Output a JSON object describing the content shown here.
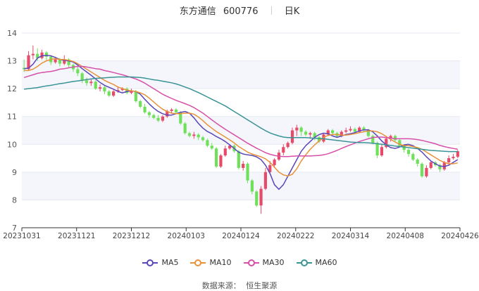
{
  "header": {
    "name": "东方通信",
    "code": "600776",
    "period": "日K"
  },
  "source": {
    "label": "数据来源：",
    "provider": "恒生聚源"
  },
  "chart_data": {
    "type": "candlestick",
    "ylim": [
      7,
      14
    ],
    "yticks": [
      7,
      8,
      9,
      10,
      11,
      12,
      13,
      14
    ],
    "xticks": [
      "20231031",
      "20231121",
      "20231212",
      "20240103",
      "20240124",
      "20240222",
      "20240314",
      "20240408",
      "20240426"
    ],
    "up_color": "#e84a6a",
    "down_color": "#6ee05a",
    "legend": [
      {
        "name": "MA5",
        "color": "#5b46b8"
      },
      {
        "name": "MA10",
        "color": "#e8923a"
      },
      {
        "name": "MA30",
        "color": "#d64fa8"
      },
      {
        "name": "MA60",
        "color": "#3a9396"
      }
    ],
    "series": [
      {
        "name": "MA5",
        "color": "#5b46b8",
        "values": [
          12.72,
          12.74,
          12.88,
          13.1,
          13.18,
          13.2,
          13.18,
          13.12,
          13.05,
          13.02,
          13.0,
          12.96,
          12.85,
          12.72,
          12.6,
          12.48,
          12.35,
          12.22,
          12.12,
          12.05,
          11.98,
          11.9,
          11.85,
          11.9,
          11.92,
          11.9,
          11.8,
          11.62,
          11.45,
          11.3,
          11.18,
          11.1,
          11.05,
          11.05,
          11.1,
          11.15,
          11.18,
          11.12,
          10.95,
          10.75,
          10.58,
          10.46,
          10.38,
          10.28,
          10.2,
          10.1,
          9.98,
          9.85,
          9.72,
          9.65,
          9.62,
          9.6,
          9.55,
          9.45,
          9.25,
          8.95,
          8.55,
          8.38,
          8.55,
          8.85,
          9.15,
          9.45,
          9.75,
          9.95,
          10.1,
          10.25,
          10.35,
          10.4,
          10.38,
          10.3,
          10.25,
          10.3,
          10.35,
          10.38,
          10.42,
          10.48,
          10.52,
          10.52,
          10.45,
          10.3,
          10.12,
          9.98,
          9.88,
          9.85,
          9.9,
          9.98,
          10.0,
          9.95,
          9.85,
          9.72,
          9.55,
          9.4,
          9.3,
          9.22,
          9.2,
          9.25,
          9.35,
          9.45
        ]
      },
      {
        "name": "MA10",
        "color": "#e8923a",
        "values": [
          12.65,
          12.65,
          12.7,
          12.8,
          12.92,
          13.0,
          13.05,
          13.08,
          13.05,
          13.05,
          13.02,
          12.98,
          12.9,
          12.8,
          12.7,
          12.6,
          12.5,
          12.4,
          12.3,
          12.22,
          12.15,
          12.06,
          12.0,
          11.95,
          11.92,
          11.9,
          11.85,
          11.78,
          11.66,
          11.52,
          11.38,
          11.26,
          11.18,
          11.12,
          11.1,
          11.1,
          11.12,
          11.12,
          11.08,
          10.98,
          10.85,
          10.7,
          10.58,
          10.46,
          10.36,
          10.26,
          10.16,
          10.05,
          9.92,
          9.82,
          9.72,
          9.65,
          9.6,
          9.55,
          9.48,
          9.35,
          9.18,
          9.0,
          8.9,
          8.86,
          8.92,
          9.12,
          9.4,
          9.62,
          9.82,
          9.98,
          10.12,
          10.25,
          10.32,
          10.35,
          10.35,
          10.33,
          10.33,
          10.35,
          10.38,
          10.42,
          10.45,
          10.48,
          10.48,
          10.45,
          10.38,
          10.28,
          10.18,
          10.08,
          10.0,
          9.95,
          9.95,
          9.92,
          9.88,
          9.82,
          9.72,
          9.62,
          9.52,
          9.42,
          9.35,
          9.3,
          9.3,
          9.33
        ]
      },
      {
        "name": "MA30",
        "color": "#d64fa8",
        "values": [
          12.4,
          12.45,
          12.5,
          12.55,
          12.58,
          12.6,
          12.62,
          12.65,
          12.7,
          12.72,
          12.75,
          12.78,
          12.8,
          12.8,
          12.78,
          12.75,
          12.72,
          12.7,
          12.65,
          12.62,
          12.58,
          12.54,
          12.5,
          12.45,
          12.4,
          12.35,
          12.28,
          12.2,
          12.1,
          12.0,
          11.9,
          11.8,
          11.72,
          11.65,
          11.58,
          11.52,
          11.46,
          11.4,
          11.32,
          11.22,
          11.12,
          11.0,
          10.88,
          10.76,
          10.65,
          10.54,
          10.44,
          10.34,
          10.24,
          10.14,
          10.04,
          9.95,
          9.86,
          9.78,
          9.7,
          9.64,
          9.6,
          9.57,
          9.56,
          9.56,
          9.57,
          9.58,
          9.58,
          9.58,
          9.58,
          9.59,
          9.6,
          9.62,
          9.66,
          9.72,
          9.78,
          9.85,
          9.92,
          9.98,
          10.04,
          10.1,
          10.15,
          10.2,
          10.24,
          10.26,
          10.26,
          10.24,
          10.22,
          10.2,
          10.2,
          10.2,
          10.2,
          10.19,
          10.17,
          10.14,
          10.1,
          10.06,
          10.02,
          9.96,
          9.92,
          9.88,
          9.85,
          9.82
        ]
      },
      {
        "name": "MA60",
        "color": "#3a9396",
        "values": [
          11.98,
          12.0,
          12.02,
          12.04,
          12.07,
          12.1,
          12.12,
          12.15,
          12.18,
          12.2,
          12.23,
          12.26,
          12.28,
          12.3,
          12.33,
          12.35,
          12.37,
          12.38,
          12.39,
          12.4,
          12.41,
          12.42,
          12.42,
          12.42,
          12.42,
          12.41,
          12.4,
          12.38,
          12.35,
          12.32,
          12.3,
          12.27,
          12.24,
          12.21,
          12.17,
          12.12,
          12.06,
          12.0,
          11.93,
          11.86,
          11.78,
          11.7,
          11.62,
          11.54,
          11.46,
          11.38,
          11.28,
          11.18,
          11.08,
          10.98,
          10.88,
          10.78,
          10.68,
          10.58,
          10.49,
          10.41,
          10.35,
          10.3,
          10.26,
          10.24,
          10.24,
          10.24,
          10.24,
          10.24,
          10.23,
          10.22,
          10.21,
          10.2,
          10.18,
          10.16,
          10.14,
          10.12,
          10.1,
          10.08,
          10.07,
          10.06,
          10.06,
          10.05,
          10.04,
          10.02,
          10.0,
          9.98,
          9.96,
          9.94,
          9.92,
          9.9,
          9.88,
          9.86,
          9.84,
          9.82,
          9.8,
          9.78,
          9.77,
          9.76,
          9.75,
          9.74,
          9.74,
          9.74
        ]
      }
    ],
    "candles": [
      [
        12.75,
        12.7,
        13.05,
        12.6
      ],
      [
        12.7,
        13.2,
        13.35,
        12.65
      ],
      [
        13.2,
        13.25,
        13.55,
        13.05
      ],
      [
        13.25,
        13.1,
        13.45,
        13.0
      ],
      [
        13.1,
        13.3,
        13.4,
        13.05
      ],
      [
        13.3,
        13.15,
        13.35,
        13.0
      ],
      [
        13.15,
        12.95,
        13.2,
        12.85
      ],
      [
        12.95,
        13.05,
        13.15,
        12.9
      ],
      [
        13.05,
        12.9,
        13.1,
        12.8
      ],
      [
        12.9,
        13.05,
        13.2,
        12.85
      ],
      [
        13.05,
        12.85,
        13.1,
        12.75
      ],
      [
        12.85,
        12.7,
        12.9,
        12.6
      ],
      [
        12.7,
        12.55,
        12.8,
        12.45
      ],
      [
        12.55,
        12.3,
        12.6,
        12.2
      ],
      [
        12.3,
        12.2,
        12.4,
        12.1
      ],
      [
        12.2,
        12.25,
        12.35,
        12.1
      ],
      [
        12.25,
        12.0,
        12.3,
        11.95
      ],
      [
        12.0,
        12.05,
        12.15,
        11.9
      ],
      [
        12.05,
        11.9,
        12.1,
        11.8
      ],
      [
        11.9,
        11.75,
        11.95,
        11.7
      ],
      [
        11.75,
        11.9,
        11.95,
        11.7
      ],
      [
        11.9,
        11.95,
        12.05,
        11.85
      ],
      [
        11.95,
        12.0,
        12.05,
        11.9
      ],
      [
        12.0,
        11.85,
        12.05,
        11.8
      ],
      [
        11.85,
        11.9,
        12.0,
        11.8
      ],
      [
        11.9,
        11.55,
        11.95,
        11.5
      ],
      [
        11.55,
        11.35,
        11.6,
        11.3
      ],
      [
        11.35,
        11.15,
        11.45,
        11.1
      ],
      [
        11.15,
        11.05,
        11.2,
        10.95
      ],
      [
        11.05,
        10.95,
        11.1,
        10.9
      ],
      [
        10.95,
        10.85,
        11.05,
        10.8
      ],
      [
        10.85,
        11.0,
        11.05,
        10.8
      ],
      [
        11.0,
        11.2,
        11.25,
        10.95
      ],
      [
        11.2,
        11.25,
        11.3,
        11.1
      ],
      [
        11.25,
        11.15,
        11.3,
        11.1
      ],
      [
        11.15,
        10.75,
        11.2,
        10.7
      ],
      [
        10.75,
        10.4,
        10.8,
        10.35
      ],
      [
        10.4,
        10.3,
        10.45,
        10.25
      ],
      [
        10.3,
        10.35,
        10.45,
        10.2
      ],
      [
        10.35,
        10.25,
        10.4,
        10.15
      ],
      [
        10.25,
        10.15,
        10.3,
        10.1
      ],
      [
        10.15,
        9.95,
        10.2,
        9.9
      ],
      [
        9.95,
        9.85,
        10.05,
        9.8
      ],
      [
        9.85,
        9.2,
        9.9,
        9.15
      ],
      [
        9.2,
        9.6,
        9.65,
        9.15
      ],
      [
        9.6,
        9.85,
        9.95,
        9.55
      ],
      [
        9.85,
        9.95,
        10.0,
        9.8
      ],
      [
        9.95,
        9.75,
        10.0,
        9.7
      ],
      [
        9.75,
        9.15,
        9.8,
        9.1
      ],
      [
        9.15,
        9.3,
        9.4,
        9.05
      ],
      [
        9.3,
        8.7,
        9.35,
        8.6
      ],
      [
        8.7,
        8.3,
        8.75,
        8.2
      ],
      [
        8.3,
        7.8,
        8.35,
        7.75
      ],
      [
        7.8,
        8.4,
        8.5,
        7.5
      ],
      [
        8.4,
        9.0,
        9.15,
        8.35
      ],
      [
        9.0,
        9.25,
        9.4,
        8.95
      ],
      [
        9.25,
        9.45,
        9.5,
        9.15
      ],
      [
        9.45,
        9.7,
        9.8,
        9.4
      ],
      [
        9.7,
        9.9,
        10.0,
        9.6
      ],
      [
        9.9,
        10.05,
        10.1,
        9.85
      ],
      [
        10.05,
        10.5,
        10.6,
        10.0
      ],
      [
        10.5,
        10.6,
        10.7,
        10.3
      ],
      [
        10.6,
        10.45,
        10.65,
        10.3
      ],
      [
        10.45,
        10.35,
        10.5,
        10.3
      ],
      [
        10.35,
        10.4,
        10.45,
        10.2
      ],
      [
        10.4,
        10.25,
        10.45,
        10.15
      ],
      [
        10.25,
        10.1,
        10.3,
        10.05
      ],
      [
        10.1,
        10.35,
        10.4,
        10.05
      ],
      [
        10.35,
        10.5,
        10.55,
        10.3
      ],
      [
        10.5,
        10.4,
        10.55,
        10.35
      ],
      [
        10.4,
        10.3,
        10.45,
        10.25
      ],
      [
        10.3,
        10.45,
        10.5,
        10.25
      ],
      [
        10.45,
        10.5,
        10.6,
        10.4
      ],
      [
        10.5,
        10.55,
        10.65,
        10.45
      ],
      [
        10.55,
        10.45,
        10.6,
        10.4
      ],
      [
        10.45,
        10.6,
        10.65,
        10.4
      ],
      [
        10.6,
        10.5,
        10.65,
        10.45
      ],
      [
        10.5,
        10.3,
        10.55,
        10.25
      ],
      [
        10.3,
        10.05,
        10.35,
        10.0
      ],
      [
        10.05,
        9.6,
        10.1,
        9.5
      ],
      [
        9.6,
        9.9,
        10.0,
        9.55
      ],
      [
        9.9,
        10.2,
        10.25,
        9.85
      ],
      [
        10.2,
        10.3,
        10.35,
        10.1
      ],
      [
        10.3,
        10.15,
        10.35,
        10.1
      ],
      [
        10.15,
        9.95,
        10.2,
        9.9
      ],
      [
        9.95,
        9.8,
        10.0,
        9.7
      ],
      [
        9.8,
        9.65,
        9.85,
        9.55
      ],
      [
        9.65,
        9.45,
        9.7,
        9.4
      ],
      [
        9.45,
        9.3,
        9.5,
        9.2
      ],
      [
        9.3,
        8.85,
        9.35,
        8.8
      ],
      [
        8.85,
        9.15,
        9.25,
        8.8
      ],
      [
        9.15,
        9.35,
        9.4,
        9.1
      ],
      [
        9.35,
        9.25,
        9.4,
        9.2
      ],
      [
        9.25,
        9.1,
        9.3,
        9.0
      ],
      [
        9.1,
        9.35,
        9.4,
        9.05
      ],
      [
        9.35,
        9.5,
        9.6,
        9.3
      ],
      [
        9.5,
        9.55,
        9.65,
        9.45
      ],
      [
        9.55,
        9.75,
        9.8,
        9.5
      ]
    ]
  }
}
